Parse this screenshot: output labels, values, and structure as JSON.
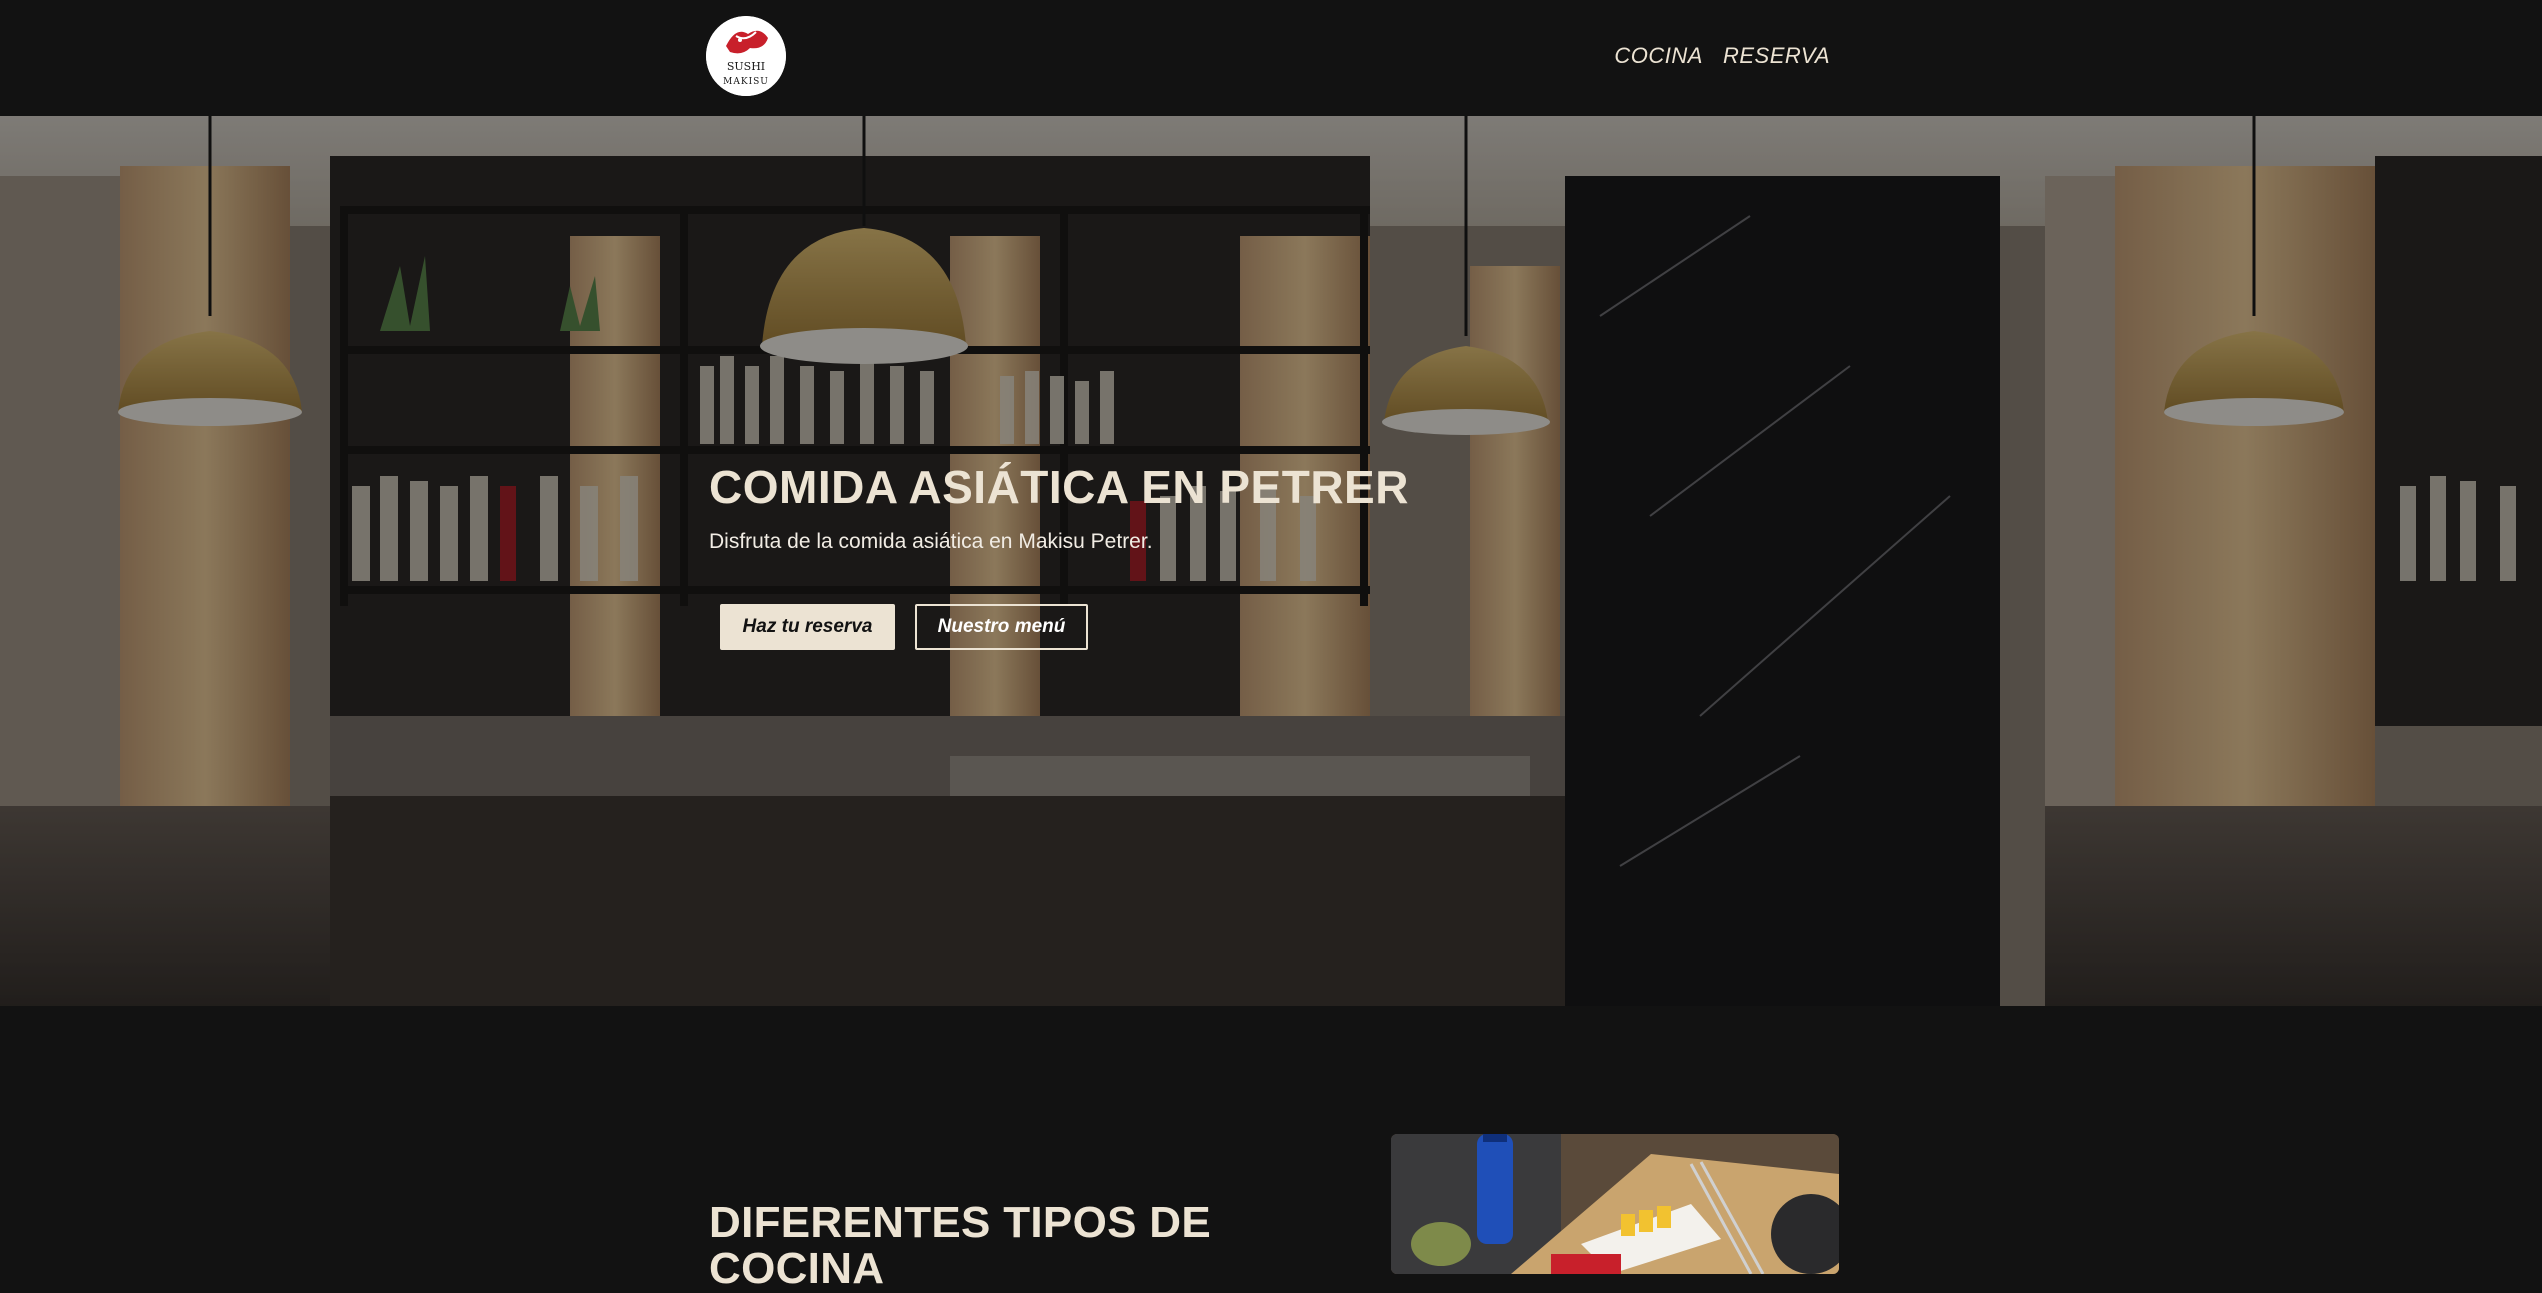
{
  "header": {
    "logo_text_top": "SUSHI",
    "logo_text_bottom": "MAKISU",
    "nav": [
      {
        "label": "COCINA"
      },
      {
        "label": "RESERVA"
      }
    ]
  },
  "hero": {
    "title": "COMIDA ASIÁTICA EN PETRER",
    "subtitle": "Disfruta de la comida asiática en Makisu Petrer.",
    "primary_button": "Haz tu reserva",
    "secondary_button": "Nuestro menú"
  },
  "section": {
    "title": "DIFERENTES TIPOS DE COCINA"
  },
  "colors": {
    "background": "#121212",
    "accent_cream": "#ece3d3",
    "logo_red": "#c8202b"
  },
  "icons": {
    "logo": "sushi-makisu-logo-icon"
  }
}
